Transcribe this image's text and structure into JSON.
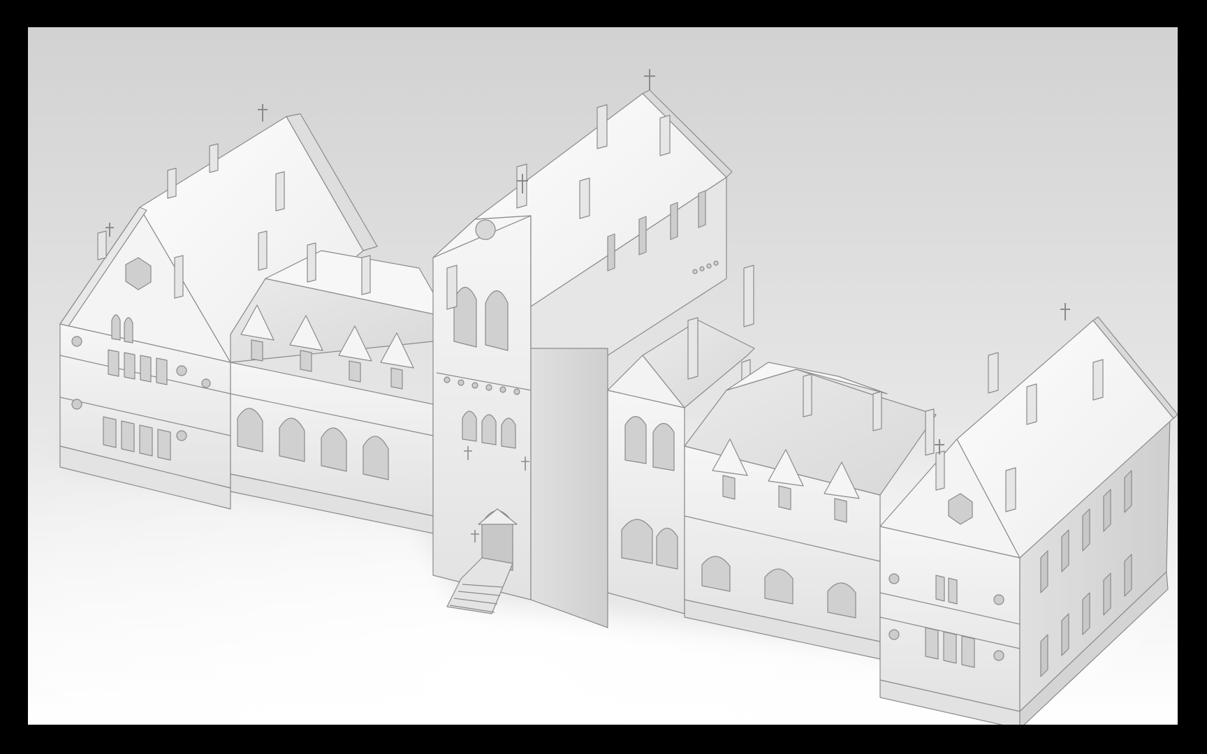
{
  "scene": {
    "subject": "",
    "colors": {
      "frame": "#000000",
      "backdrop_top": "#d6d6d6",
      "backdrop_bottom": "#ffffff",
      "wall": "#f2f2f2",
      "wall_shade": "#dcdcdc",
      "wall_dark": "#c4c4c4",
      "roof_light": "#fafafa",
      "roof_shade": "#e4e4e4",
      "line": "#8a8a8a",
      "window": "#cfcfcf"
    }
  }
}
